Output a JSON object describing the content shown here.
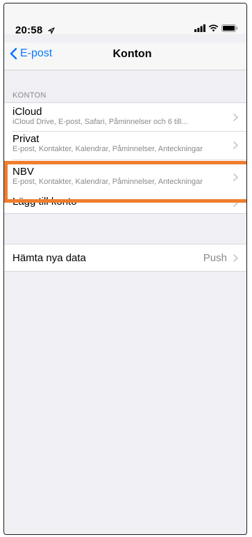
{
  "status_bar": {
    "time": "20:58"
  },
  "nav": {
    "back_label": "E-post",
    "title": "Konton"
  },
  "accounts_section": {
    "header": "KONTON",
    "accounts": [
      {
        "name": "iCloud",
        "detail": "iCloud Drive, E-post, Safari, Påminnelser och 6 till..."
      },
      {
        "name": "Privat",
        "detail": "E-post, Kontakter, Kalendrar, Påminnelser, Anteckningar"
      },
      {
        "name": "NBV",
        "detail": "E-post, Kontakter, Kalendrar, Påminnelser, Anteckningar"
      }
    ],
    "add_account": "Lägg till konto"
  },
  "fetch_section": {
    "label": "Hämta nya data",
    "value": "Push"
  },
  "colors": {
    "accent": "#0a7aff",
    "highlight": "#ef7d2d",
    "background": "#efeff4"
  }
}
